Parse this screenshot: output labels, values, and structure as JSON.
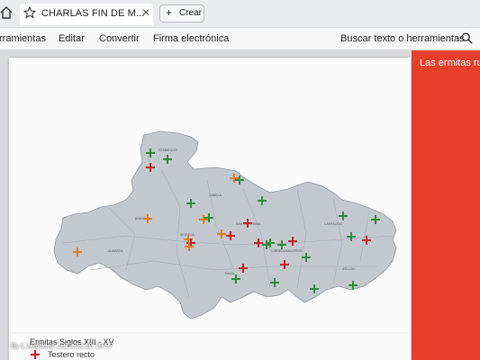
{
  "tab": {
    "title": "CHARLAS FIN DE M...",
    "close": "✕"
  },
  "toolbar": {
    "create_label": "Crear",
    "create_plus": "+"
  },
  "menu": {
    "items": [
      "rramientas",
      "Editar",
      "Convertir",
      "Firma electrónica"
    ],
    "search": "Buscar texto o herramientas"
  },
  "side_panel": {
    "text": "Las ermitas rur"
  },
  "legend": {
    "title": "Ermitas Siglos XIII - XV",
    "item": "Testero recto"
  },
  "watermark": "By L.Martinez  2020.02.20 19:57",
  "markers": {
    "green": "#2e8b3e",
    "red": "#c0242a",
    "orange": "#e07a1c"
  }
}
